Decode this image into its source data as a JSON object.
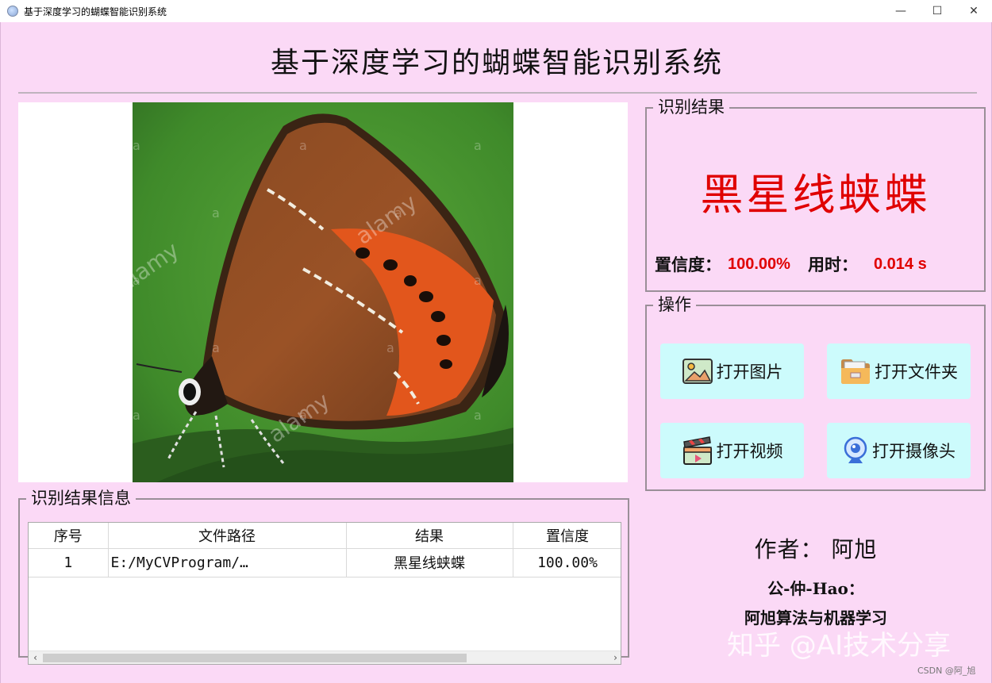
{
  "window": {
    "title": "基于深度学习的蝴蝶智能识别系统",
    "minimize": "—",
    "maximize": "☐",
    "close": "✕"
  },
  "header": {
    "title": "基于深度学习的蝴蝶智能识别系统"
  },
  "result": {
    "legend": "识别结果",
    "name": "黑星线蛱蝶",
    "confidence_label": "置信度：",
    "confidence_value": "100.00%",
    "time_label": "用时：",
    "time_value": "0.014 s"
  },
  "operations": {
    "legend": "操作",
    "open_image": "打开图片",
    "open_folder": "打开文件夹",
    "open_video": "打开视频",
    "open_camera": "打开摄像头"
  },
  "table": {
    "legend": "识别结果信息",
    "columns": [
      "序号",
      "文件路径",
      "结果",
      "置信度"
    ],
    "rows": [
      {
        "index": "1",
        "path": "E:/MyCVProgram/…",
        "result": "黑星线蛱蝶",
        "confidence": "100.00%"
      }
    ],
    "scroll_left": "‹",
    "scroll_right": "›"
  },
  "author": {
    "line": "作者：  阿旭",
    "gzh": "公-仲-Hao：",
    "subtitle": "阿旭算法与机器学习"
  },
  "overlays": {
    "watermark": "知乎 @AI技术分享",
    "csdn": "CSDN @阿_旭"
  },
  "colors": {
    "background": "#fbd9f6",
    "accent_red": "#e00000",
    "button_bg": "#ccfbfc"
  }
}
